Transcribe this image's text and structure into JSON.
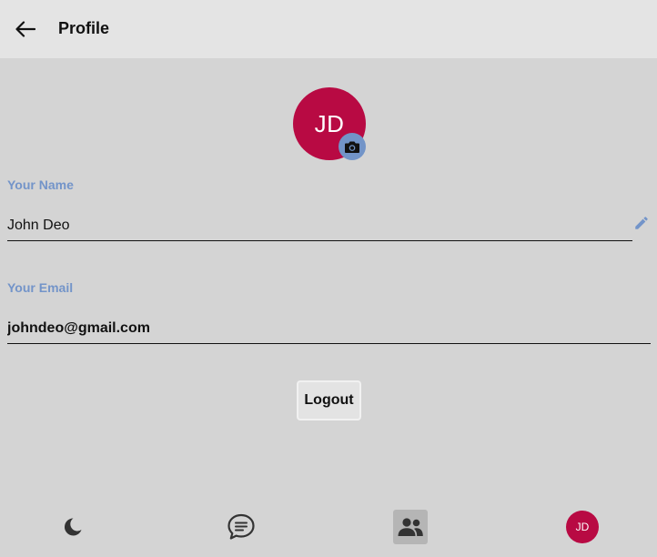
{
  "header": {
    "title": "Profile",
    "back_icon": "arrow-left-icon"
  },
  "profile": {
    "initials": "JD",
    "camera_icon": "camera-icon"
  },
  "form": {
    "name": {
      "label": "Your Name",
      "value": "John Deo",
      "edit_icon": "pencil-icon"
    },
    "email": {
      "label": "Your Email",
      "value": "johndeo@gmail.com"
    }
  },
  "actions": {
    "logout_label": "Logout"
  },
  "bottom_nav": {
    "items": [
      {
        "icon": "moon-icon",
        "active": false
      },
      {
        "icon": "chat-bubble-icon",
        "active": false
      },
      {
        "icon": "users-icon",
        "active": true
      },
      {
        "icon": "avatar",
        "initials": "JD",
        "active": false
      }
    ]
  },
  "colors": {
    "brand": "#b80a43",
    "label": "#7394c9",
    "camera_badge": "#7294c8",
    "background": "#d4d4d4",
    "header": "#e4e4e4"
  }
}
